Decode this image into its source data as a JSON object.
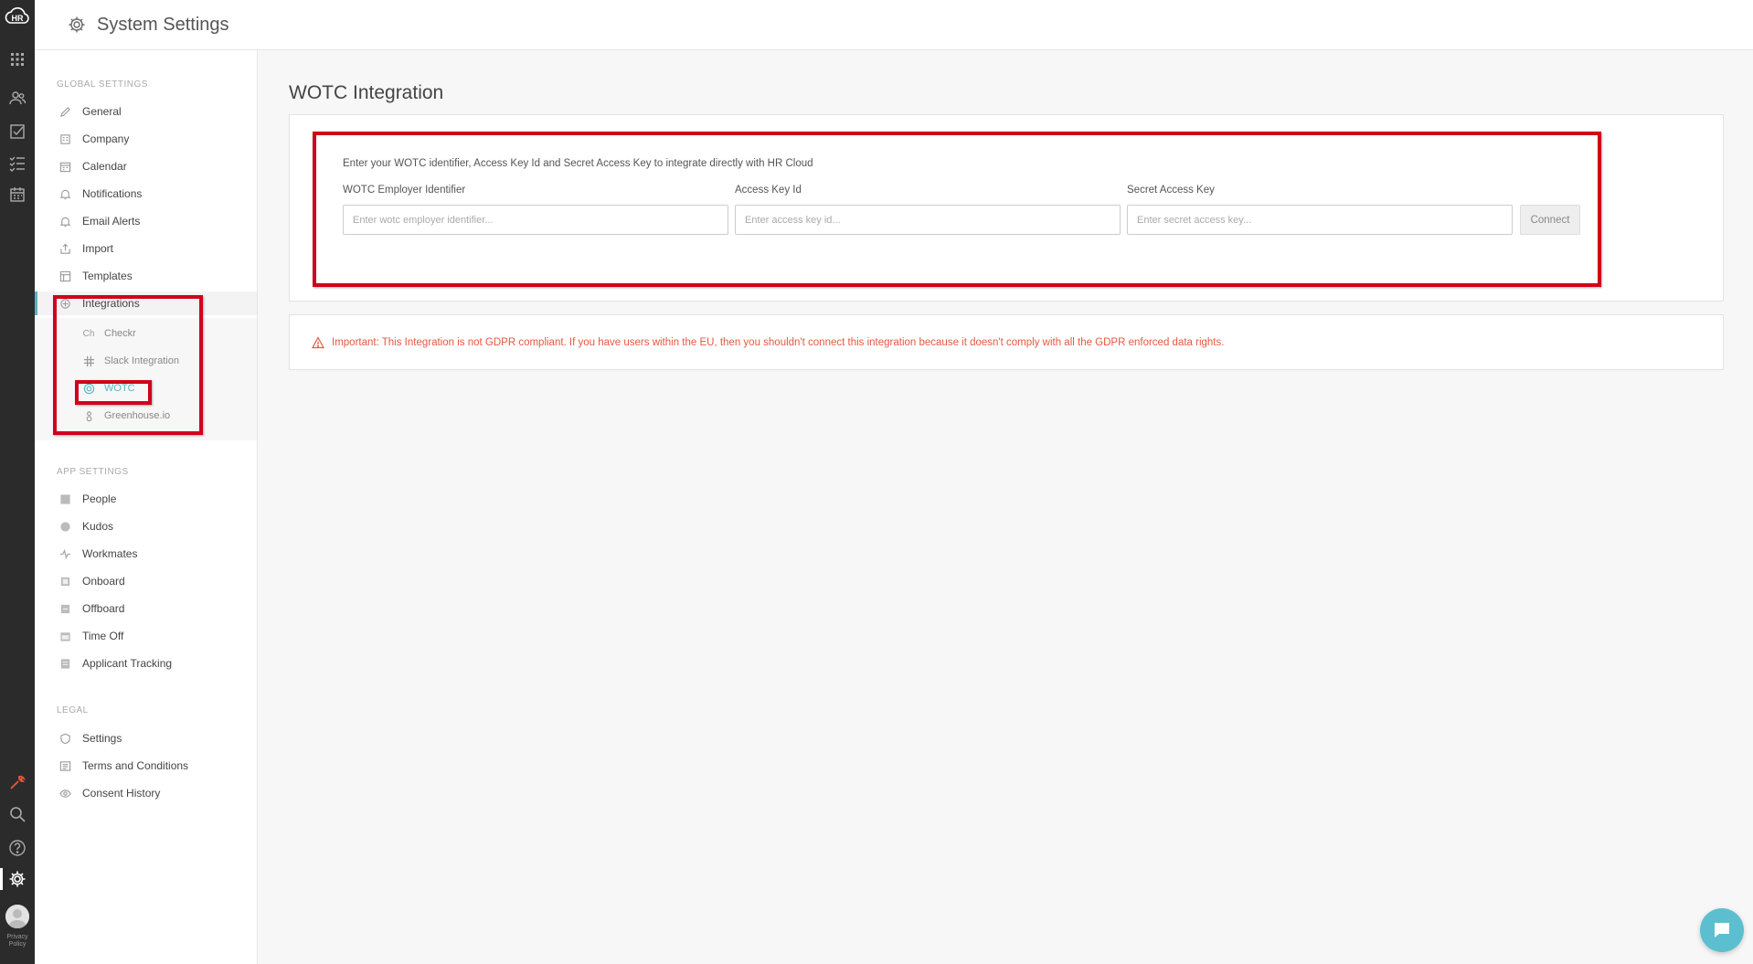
{
  "app": {
    "logo_text": "HR",
    "privacy_label": "Privacy Policy"
  },
  "rail": {
    "icons": [
      "apps-grid-icon",
      "people-icon",
      "checkbox-icon",
      "checklist-icon",
      "calendar-icon",
      "wrench-icon",
      "search-icon",
      "help-icon",
      "settings-icon"
    ]
  },
  "header": {
    "title": "System Settings"
  },
  "sidebar": {
    "global_title": "GLOBAL SETTINGS",
    "global_items": [
      {
        "label": "General",
        "icon": "pencil-icon"
      },
      {
        "label": "Company",
        "icon": "building-icon"
      },
      {
        "label": "Calendar",
        "icon": "calendar-icon"
      },
      {
        "label": "Notifications",
        "icon": "bell-icon"
      },
      {
        "label": "Email Alerts",
        "icon": "bell-icon"
      },
      {
        "label": "Import",
        "icon": "import-icon"
      },
      {
        "label": "Templates",
        "icon": "template-icon"
      },
      {
        "label": "Integrations",
        "icon": "integrations-icon"
      }
    ],
    "integration_subitems": [
      {
        "label": "Checkr",
        "icon_text": "Ch"
      },
      {
        "label": "Slack Integration",
        "icon": "slack-icon"
      },
      {
        "label": "WOTC",
        "icon": "wotc-icon"
      },
      {
        "label": "Greenhouse.io",
        "icon": "greenhouse-icon"
      }
    ],
    "app_title": "APP SETTINGS",
    "app_items": [
      {
        "label": "People"
      },
      {
        "label": "Kudos"
      },
      {
        "label": "Workmates"
      },
      {
        "label": "Onboard"
      },
      {
        "label": "Offboard"
      },
      {
        "label": "Time Off"
      },
      {
        "label": "Applicant Tracking"
      }
    ],
    "legal_title": "LEGAL",
    "legal_items": [
      {
        "label": "Settings"
      },
      {
        "label": "Terms and Conditions"
      },
      {
        "label": "Consent History"
      }
    ]
  },
  "main": {
    "title": "WOTC Integration",
    "intro": "Enter your WOTC identifier, Access Key Id and Secret Access Key to integrate directly with HR Cloud",
    "fields": [
      {
        "label": "WOTC Employer Identifier",
        "placeholder": "Enter wotc employer identifier...",
        "value": ""
      },
      {
        "label": "Access Key Id",
        "placeholder": "Enter access key id...",
        "value": ""
      },
      {
        "label": "Secret Access Key",
        "placeholder": "Enter secret access key...",
        "value": ""
      }
    ],
    "connect_label": "Connect",
    "warning": "Important: This Integration is not GDPR compliant. If you have users within the EU, then you shouldn't connect this integration because it doesn't comply with all the GDPR enforced data rights."
  },
  "colors": {
    "accent": "#55b5c0",
    "highlight": "#d0021b",
    "warning": "#e9573f",
    "rail": "#2b2b2b"
  }
}
